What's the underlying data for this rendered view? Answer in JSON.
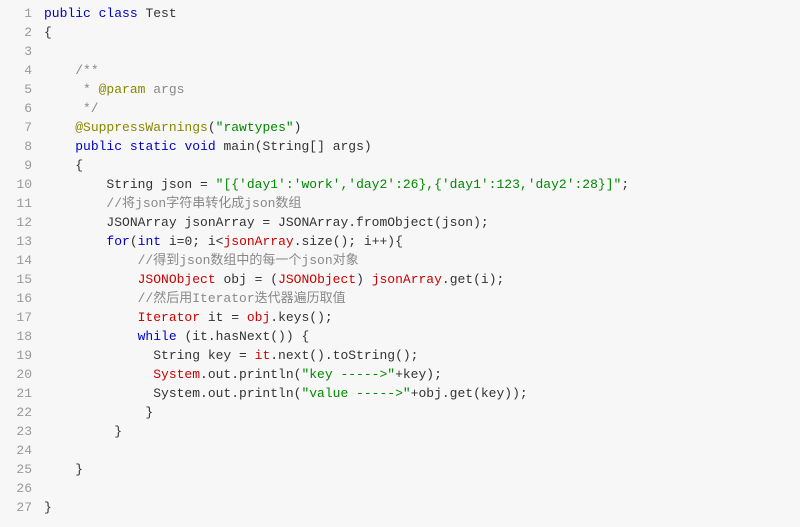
{
  "lines": [
    {
      "num": "1",
      "tokens": [
        {
          "t": "public",
          "c": "kw"
        },
        {
          "t": " "
        },
        {
          "t": "class",
          "c": "kw"
        },
        {
          "t": " Test"
        }
      ]
    },
    {
      "num": "2",
      "tokens": [
        {
          "t": "{"
        }
      ]
    },
    {
      "num": "3",
      "tokens": [
        {
          "t": " "
        }
      ]
    },
    {
      "num": "4",
      "tokens": [
        {
          "t": "    "
        },
        {
          "t": "/**",
          "c": "comment"
        }
      ]
    },
    {
      "num": "5",
      "tokens": [
        {
          "t": "     * ",
          "c": "comment"
        },
        {
          "t": "@param",
          "c": "ann"
        },
        {
          "t": " args",
          "c": "comment"
        }
      ]
    },
    {
      "num": "6",
      "tokens": [
        {
          "t": "     */",
          "c": "comment"
        }
      ]
    },
    {
      "num": "7",
      "tokens": [
        {
          "t": "    "
        },
        {
          "t": "@SuppressWarnings",
          "c": "ann"
        },
        {
          "t": "("
        },
        {
          "t": "\"rawtypes\"",
          "c": "str"
        },
        {
          "t": ")"
        }
      ]
    },
    {
      "num": "8",
      "tokens": [
        {
          "t": "    "
        },
        {
          "t": "public",
          "c": "kw"
        },
        {
          "t": " "
        },
        {
          "t": "static",
          "c": "kw"
        },
        {
          "t": " "
        },
        {
          "t": "void",
          "c": "kw"
        },
        {
          "t": " main(String[] args)"
        }
      ]
    },
    {
      "num": "9",
      "tokens": [
        {
          "t": "    {"
        }
      ]
    },
    {
      "num": "10",
      "tokens": [
        {
          "t": "        String json = "
        },
        {
          "t": "\"[{'day1':'work','day2':26},{'day1':123,'day2':28}]\"",
          "c": "str"
        },
        {
          "t": ";"
        }
      ]
    },
    {
      "num": "11",
      "tokens": [
        {
          "t": "        "
        },
        {
          "t": "//将json字符串转化成json数组",
          "c": "comment"
        }
      ]
    },
    {
      "num": "12",
      "tokens": [
        {
          "t": "        JSONArray jsonArray = JSONArray.fromObject(json);"
        }
      ]
    },
    {
      "num": "13",
      "tokens": [
        {
          "t": "        "
        },
        {
          "t": "for",
          "c": "kw"
        },
        {
          "t": "("
        },
        {
          "t": "int",
          "c": "kw"
        },
        {
          "t": " i=0; i<"
        },
        {
          "t": "jsonArray",
          "c": "err"
        },
        {
          "t": ".size(); i++){"
        }
      ]
    },
    {
      "num": "14",
      "tokens": [
        {
          "t": "            "
        },
        {
          "t": "//得到json数组中的每一个json对象",
          "c": "comment"
        }
      ]
    },
    {
      "num": "15",
      "tokens": [
        {
          "t": "            "
        },
        {
          "t": "JSONObject",
          "c": "err"
        },
        {
          "t": " obj = ("
        },
        {
          "t": "JSONObject",
          "c": "err"
        },
        {
          "t": ") "
        },
        {
          "t": "jsonArray",
          "c": "err"
        },
        {
          "t": ".get(i);"
        }
      ]
    },
    {
      "num": "16",
      "tokens": [
        {
          "t": "            "
        },
        {
          "t": "//然后用Iterator迭代器遍历取值",
          "c": "comment"
        }
      ]
    },
    {
      "num": "17",
      "tokens": [
        {
          "t": "            "
        },
        {
          "t": "Iterator",
          "c": "err"
        },
        {
          "t": " it = "
        },
        {
          "t": "obj",
          "c": "err"
        },
        {
          "t": ".keys();"
        }
      ]
    },
    {
      "num": "18",
      "tokens": [
        {
          "t": "            "
        },
        {
          "t": "while",
          "c": "kw"
        },
        {
          "t": " (it.hasNext()) {"
        }
      ]
    },
    {
      "num": "19",
      "tokens": [
        {
          "t": "              String key = "
        },
        {
          "t": "it",
          "c": "err"
        },
        {
          "t": ".next().toString();"
        }
      ]
    },
    {
      "num": "20",
      "tokens": [
        {
          "t": "              "
        },
        {
          "t": "System",
          "c": "err"
        },
        {
          "t": ".out.println("
        },
        {
          "t": "\"key ----->\"",
          "c": "str"
        },
        {
          "t": "+key);"
        }
      ]
    },
    {
      "num": "21",
      "tokens": [
        {
          "t": "              System.out.println("
        },
        {
          "t": "\"value ----->\"",
          "c": "str"
        },
        {
          "t": "+obj.get(key));"
        }
      ]
    },
    {
      "num": "22",
      "tokens": [
        {
          "t": "             }"
        }
      ]
    },
    {
      "num": "23",
      "tokens": [
        {
          "t": "         }"
        }
      ]
    },
    {
      "num": "24",
      "tokens": [
        {
          "t": " "
        }
      ]
    },
    {
      "num": "25",
      "tokens": [
        {
          "t": "    }"
        }
      ]
    },
    {
      "num": "26",
      "tokens": [
        {
          "t": " "
        }
      ]
    },
    {
      "num": "27",
      "tokens": [
        {
          "t": "}"
        }
      ]
    }
  ]
}
